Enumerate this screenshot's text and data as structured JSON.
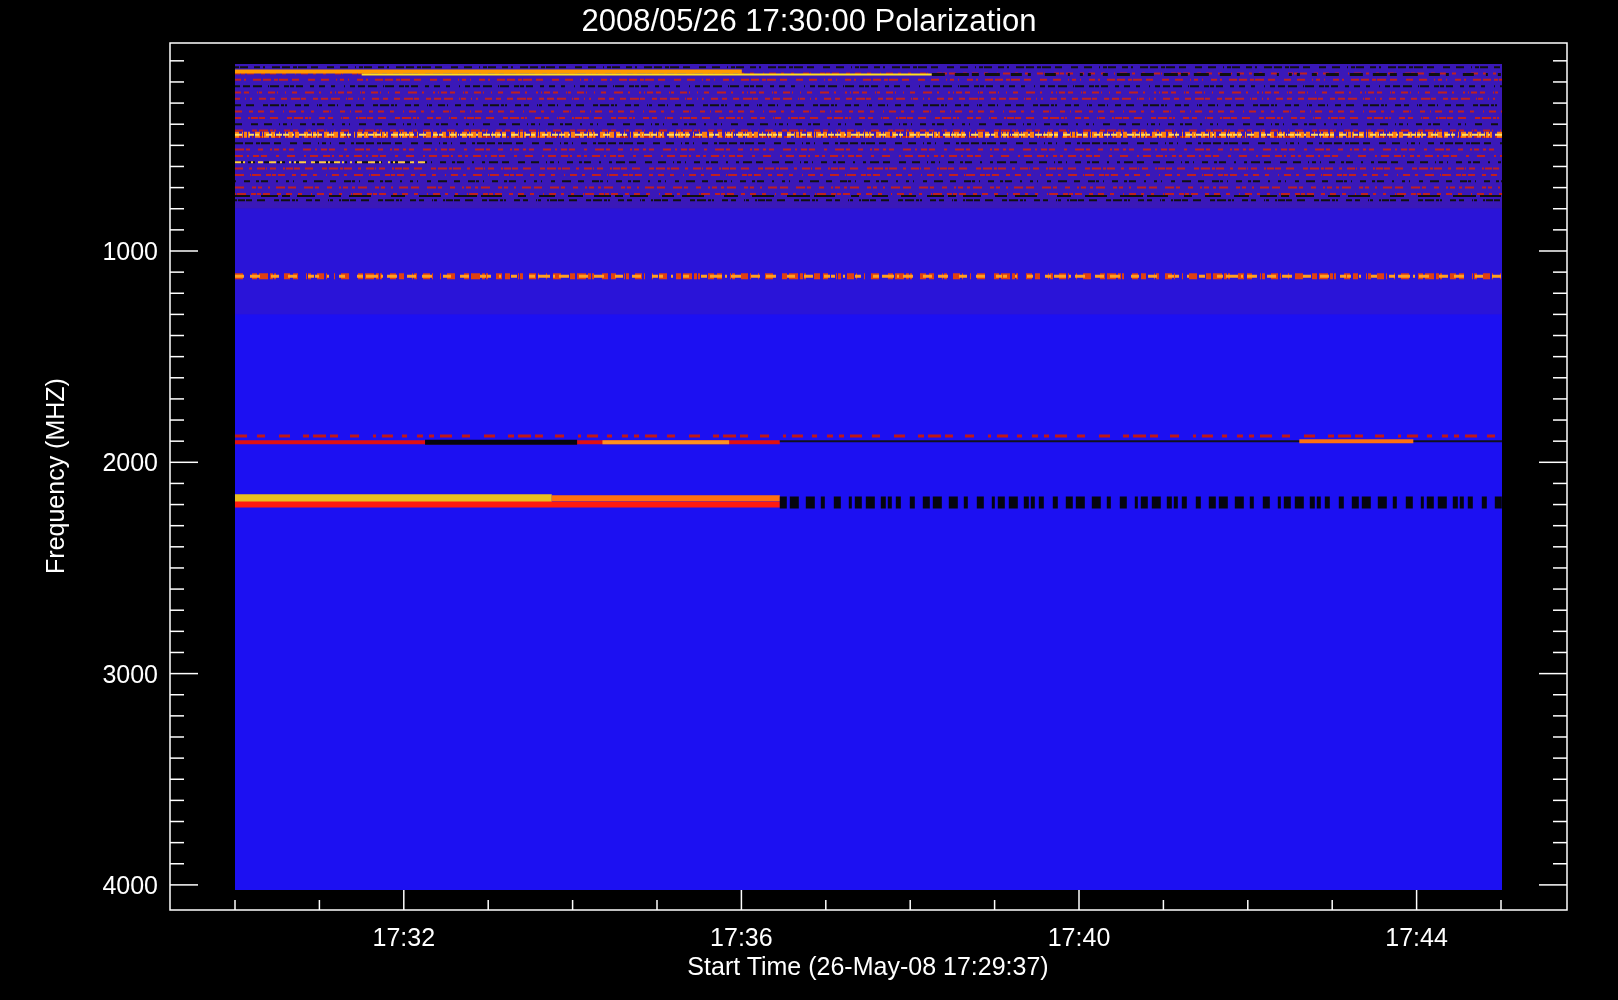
{
  "title": "2008/05/26 17:30:00 Polarization",
  "y_axis": {
    "label": "Frequency (MHZ)",
    "ticks": [
      "1000",
      "2000",
      "3000",
      "4000"
    ]
  },
  "x_axis": {
    "label": "Start Time (26-May-08 17:29:37)",
    "ticks": [
      "17:32",
      "17:36",
      "17:40",
      "17:44"
    ]
  }
}
